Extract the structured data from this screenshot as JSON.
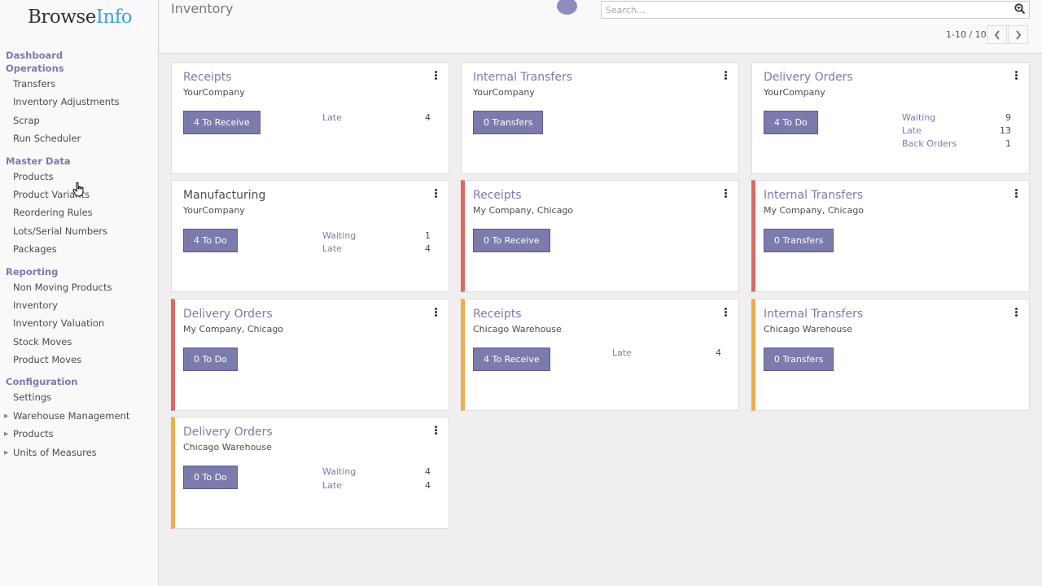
{
  "logo": {
    "part1": "Browse",
    "part2": "Info"
  },
  "sidebar": {
    "sections": [
      {
        "title": "Dashboard",
        "items": []
      },
      {
        "title": "Operations",
        "items": [
          "Transfers",
          "Inventory Adjustments",
          "Scrap",
          "Run Scheduler"
        ]
      },
      {
        "title": "Master Data",
        "items": [
          "Products",
          "Product Variants",
          "Reordering Rules",
          "Lots/Serial Numbers",
          "Packages"
        ]
      },
      {
        "title": "Reporting",
        "items": [
          "Non Moving Products",
          "Inventory",
          "Inventory Valuation",
          "Stock Moves",
          "Product Moves"
        ]
      },
      {
        "title": "Configuration",
        "items": [
          "Settings",
          "Warehouse Management",
          "Products",
          "Units of Measures"
        ]
      }
    ]
  },
  "header": {
    "title": "Inventory",
    "search_placeholder": "Search...",
    "pager": "1-10 / 10"
  },
  "cards": [
    {
      "title": "Receipts",
      "subtitle": "YourCompany",
      "button": "4 To Receive",
      "stats": [
        {
          "label": "Late",
          "value": "4"
        }
      ]
    },
    {
      "title": "Internal Transfers",
      "subtitle": "YourCompany",
      "button": "0 Transfers",
      "stats": []
    },
    {
      "title": "Delivery Orders",
      "subtitle": "YourCompany",
      "button": "4 To Do",
      "stats": [
        {
          "label": "Waiting",
          "value": "9"
        },
        {
          "label": "Late",
          "value": "13"
        },
        {
          "label": "Back Orders",
          "value": "1"
        }
      ]
    },
    {
      "title": "Manufacturing",
      "subtitle": "YourCompany",
      "button": "4 To Do",
      "stats": [
        {
          "label": "Waiting",
          "value": "1"
        },
        {
          "label": "Late",
          "value": "4"
        }
      ]
    },
    {
      "title": "Receipts",
      "subtitle": "My Company, Chicago",
      "button": "0 To Receive",
      "stats": []
    },
    {
      "title": "Internal Transfers",
      "subtitle": "My Company, Chicago",
      "button": "0 Transfers",
      "stats": []
    },
    {
      "title": "Delivery Orders",
      "subtitle": "My Company, Chicago",
      "button": "0 To Do",
      "stats": []
    },
    {
      "title": "Receipts",
      "subtitle": "Chicago Warehouse",
      "button": "4 To Receive",
      "stats": [
        {
          "label": "Late",
          "value": "4"
        }
      ]
    },
    {
      "title": "Internal Transfers",
      "subtitle": "Chicago Warehouse",
      "button": "0 Transfers",
      "stats": []
    },
    {
      "title": "Delivery Orders",
      "subtitle": "Chicago Warehouse",
      "button": "0 To Do",
      "stats": [
        {
          "label": "Waiting",
          "value": "4"
        },
        {
          "label": "Late",
          "value": "4"
        }
      ]
    }
  ],
  "colors": {
    "accent": "#7c7bad",
    "late_border": "#dc6965",
    "warning_border": "#f0ad4e"
  },
  "icons": {
    "search": "search-icon",
    "kebab": "kebab-icon",
    "prev": "chevron-left-icon",
    "next": "chevron-right-icon",
    "cursor": "hand-cursor-icon"
  }
}
